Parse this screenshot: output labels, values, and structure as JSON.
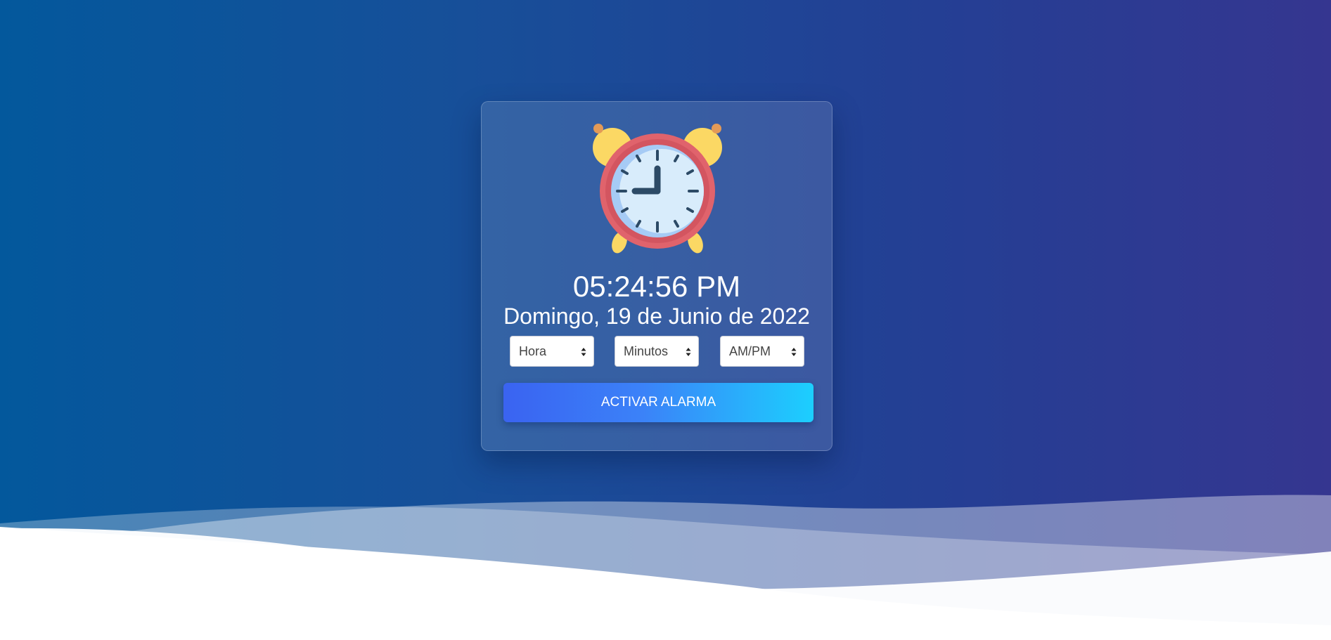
{
  "clock": {
    "time": "05:24:56 PM",
    "date": "Domingo, 19 de Junio de 2022",
    "icon": "alarm-clock-icon"
  },
  "controls": {
    "hour_select": {
      "value": "Hora"
    },
    "minute_select": {
      "value": "Minutos"
    },
    "ampm_select": {
      "value": "AM/PM"
    },
    "activate_button_label": "ACTIVAR ALARMA"
  },
  "colors": {
    "background_start": "#03589c",
    "background_end": "#353690",
    "button_start": "#3a63f1",
    "button_end": "#1ccffe",
    "clock_ring": "#e0636c",
    "clock_bells": "#fbd864"
  }
}
